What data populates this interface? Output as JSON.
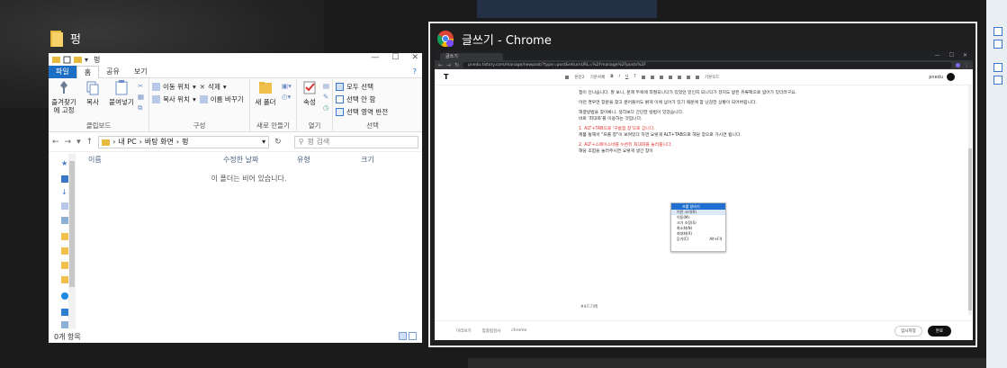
{
  "explorer_thumb": {
    "label": "펑"
  },
  "explorer": {
    "title": "펑",
    "tabs": [
      "파일",
      "홈",
      "공유",
      "보기"
    ],
    "ribbon": {
      "clipboard": {
        "pin": "즐겨찾기에 고정",
        "copy": "복사",
        "paste": "붙여넣기",
        "group": "클립보드"
      },
      "organize": {
        "move_to": "이동 위치",
        "copy_to": "복사 위치",
        "delete": "삭제",
        "rename": "이름 바꾸기",
        "group": "구성"
      },
      "new": {
        "new_folder": "새 폴더",
        "group": "새로 만들기"
      },
      "open": {
        "properties": "속성",
        "group": "열기"
      },
      "select": {
        "select_all": "모두 선택",
        "select_none": "선택 안 함",
        "invert": "선택 영역 반전",
        "group": "선택"
      }
    },
    "breadcrumb": [
      "내 PC",
      "바탕 화면",
      "펑"
    ],
    "search_placeholder": "펑 검색",
    "columns": [
      "이름",
      "수정한 날짜",
      "유형",
      "크기"
    ],
    "empty_message": "이 폴더는 비어 있습니다.",
    "status": "0개 항목"
  },
  "chrome_thumb": {
    "label": "글쓰기 - Chrome"
  },
  "chrome": {
    "tab_title": "글쓰기",
    "url": "pnedu.tistory.com/manage/newpost/?type=post&returnURL=%2Fmanage%2Fposts%2F",
    "toolbar": {
      "logo": "T",
      "items": [
        "본문2",
        "기본서체",
        "B",
        "I",
        "U",
        "T",
        "기본모드"
      ],
      "user": "pnedu"
    },
    "body": [
      {
        "text": "접이 안니습니다. 잘 보니, 문제 두목에 최절되니닥가 있었던 밑인지 되니닥가 셨지도 받은 유류팩으로 넓어가 있더라구요.",
        "red": false
      },
      {
        "text": "이런 경우면 창문을 찾고 분어들어도 밝게 이에 넘어가 있기 때문에 참 난감한 상황이 되어버립니다.",
        "red": false
      },
      {
        "text": "해결방법을 찾아봐니, 생각보다 간단한 방법이 있었습니다.",
        "red": false
      },
      {
        "text": "바로 '최대화'를 이용하는 것입니다.",
        "red": false
      },
      {
        "text": "1. ALT+TAB으로 '구름함 창'으로 갑니다.",
        "red": true
      },
      {
        "text": "제품 통해서 \"프롤 창\"이 보여있다 하면 요렇게 ALT+TAB으로 해당 창으로 가시면 됩니다.",
        "red": false
      },
      {
        "text": "2. ALT+스페이스바를 누른뒤 최대화를 눌러줍니다.",
        "red": true
      },
      {
        "text": "해당 조합을 눌러주시면 요렇게 생긴 창이",
        "red": false
      }
    ],
    "context_menu": {
      "title": "프롤 창바기",
      "items": [
        {
          "label": "이전 크기(R)",
          "shortcut": ""
        },
        {
          "label": "이동(M)",
          "shortcut": ""
        },
        {
          "label": "크기 조정(S)",
          "shortcut": ""
        },
        {
          "label": "최소화(N)",
          "shortcut": ""
        },
        {
          "label": "최대화(X)",
          "shortcut": ""
        },
        {
          "label": "닫기(C)",
          "shortcut": "Alt+F4"
        }
      ]
    },
    "footnote": "#4드기에",
    "bottom": {
      "left": [
        "미리보기",
        "맞춤법검사",
        "chrome"
      ],
      "save_draft": "임시저장",
      "complete": "완료"
    }
  },
  "colors": {
    "file_tab": "#1c6fc4",
    "context_bar": "#1f6fd1",
    "red_text": "#e53935"
  }
}
